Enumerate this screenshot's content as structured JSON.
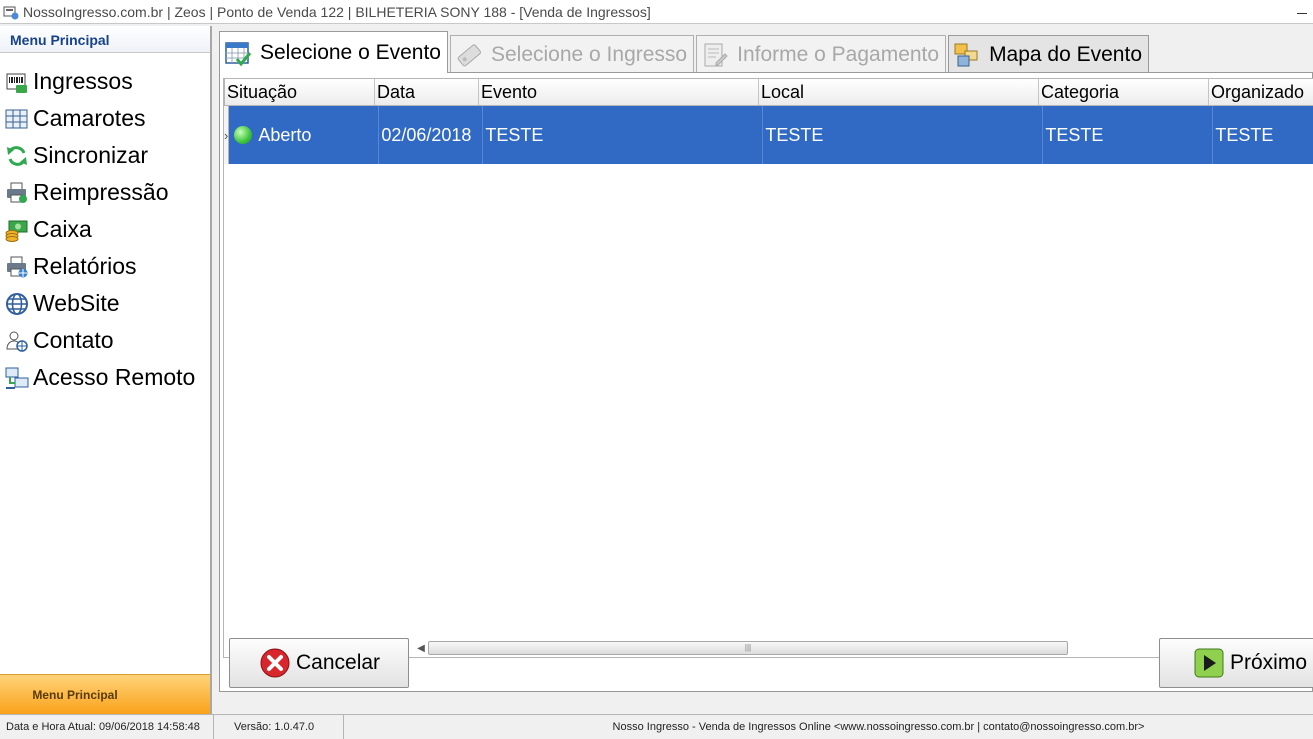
{
  "window": {
    "title": "NossoIngresso.com.br | Zeos | Ponto de Venda 122 | BILHETERIA SONY 188 - [Venda de Ingressos]"
  },
  "sidebar": {
    "header": "Menu Principal",
    "footer": "Menu Principal",
    "items": [
      {
        "label": "Ingressos",
        "icon": "ticket-barcode-icon"
      },
      {
        "label": "Camarotes",
        "icon": "grid-box-icon"
      },
      {
        "label": "Sincronizar",
        "icon": "sync-icon"
      },
      {
        "label": "Reimpressão",
        "icon": "printer-icon"
      },
      {
        "label": "Caixa",
        "icon": "cash-icon"
      },
      {
        "label": "Relatórios",
        "icon": "printer-report-icon"
      },
      {
        "label": "WebSite",
        "icon": "globe-icon"
      },
      {
        "label": "Contato",
        "icon": "contact-icon"
      },
      {
        "label": "Acesso Remoto",
        "icon": "remote-access-icon"
      }
    ]
  },
  "tabs": [
    {
      "label": "Selecione o Evento",
      "state": "active",
      "icon": "calendar-check-icon"
    },
    {
      "label": "Selecione o Ingresso",
      "state": "disabled",
      "icon": "ticket-icon"
    },
    {
      "label": "Informe o Pagamento",
      "state": "disabled",
      "icon": "form-edit-icon"
    },
    {
      "label": "Mapa do Evento",
      "state": "normal",
      "icon": "map-blocks-icon"
    }
  ],
  "grid": {
    "columns": [
      "Situação",
      "Data",
      "Evento",
      "Local",
      "Categoria",
      "Organizado"
    ],
    "rows": [
      {
        "situacao": "Aberto",
        "data": "02/06/2018",
        "evento": "TESTE",
        "local": "TESTE",
        "categoria": "TESTE",
        "organizador": "TESTE",
        "selected": true,
        "status_color": "#3cc43c"
      }
    ]
  },
  "buttons": {
    "cancel": "Cancelar",
    "next": "Próximo"
  },
  "statusbar": {
    "datetime": "Data e Hora Atual: 09/06/2018 14:58:48",
    "version": "Versão: 1.0.47.0",
    "info": "Nosso Ingresso - Venda de Ingressos Online <www.nossoingresso.com.br | contato@nossoingresso.com.br>"
  },
  "colors": {
    "selection": "#316ac5",
    "sidebar_header_text": "#15428b",
    "footer_orange": "#f9a21a"
  }
}
